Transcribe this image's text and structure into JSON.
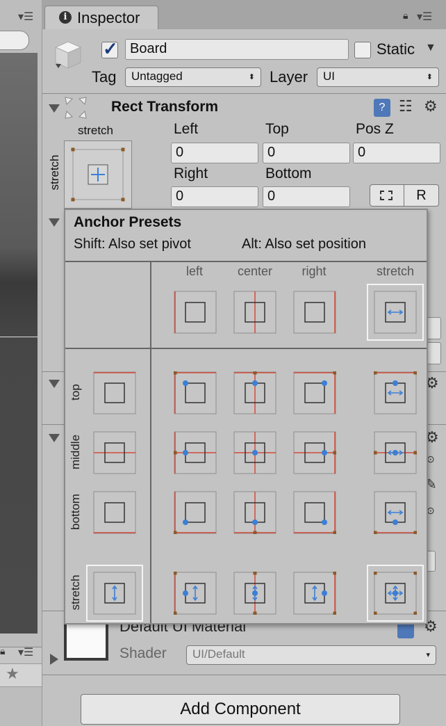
{
  "inspector": {
    "tab_title": "Inspector",
    "object_name": "Board",
    "static_label": "Static",
    "tag_label": "Tag",
    "tag_value": "Untagged",
    "layer_label": "Layer",
    "layer_value": "UI"
  },
  "rect_transform": {
    "title": "Rect Transform",
    "anchor_h": "stretch",
    "anchor_v": "stretch",
    "fields": {
      "left_label": "Left",
      "left_value": "0",
      "top_label": "Top",
      "top_value": "0",
      "posz_label": "Pos Z",
      "posz_value": "0",
      "right_label": "Right",
      "right_value": "0",
      "bottom_label": "Bottom",
      "bottom_value": "0"
    },
    "raw_button": "R"
  },
  "anchor_presets": {
    "title": "Anchor Presets",
    "hint_shift": "Shift: Also set pivot",
    "hint_alt": "Alt: Also set position",
    "columns": [
      "left",
      "center",
      "right",
      "stretch"
    ],
    "rows": [
      "top",
      "middle",
      "bottom",
      "stretch"
    ]
  },
  "material": {
    "name": "Default UI Material",
    "shader_label": "Shader",
    "shader_value": "UI/Default"
  },
  "add_component": "Add Component"
}
